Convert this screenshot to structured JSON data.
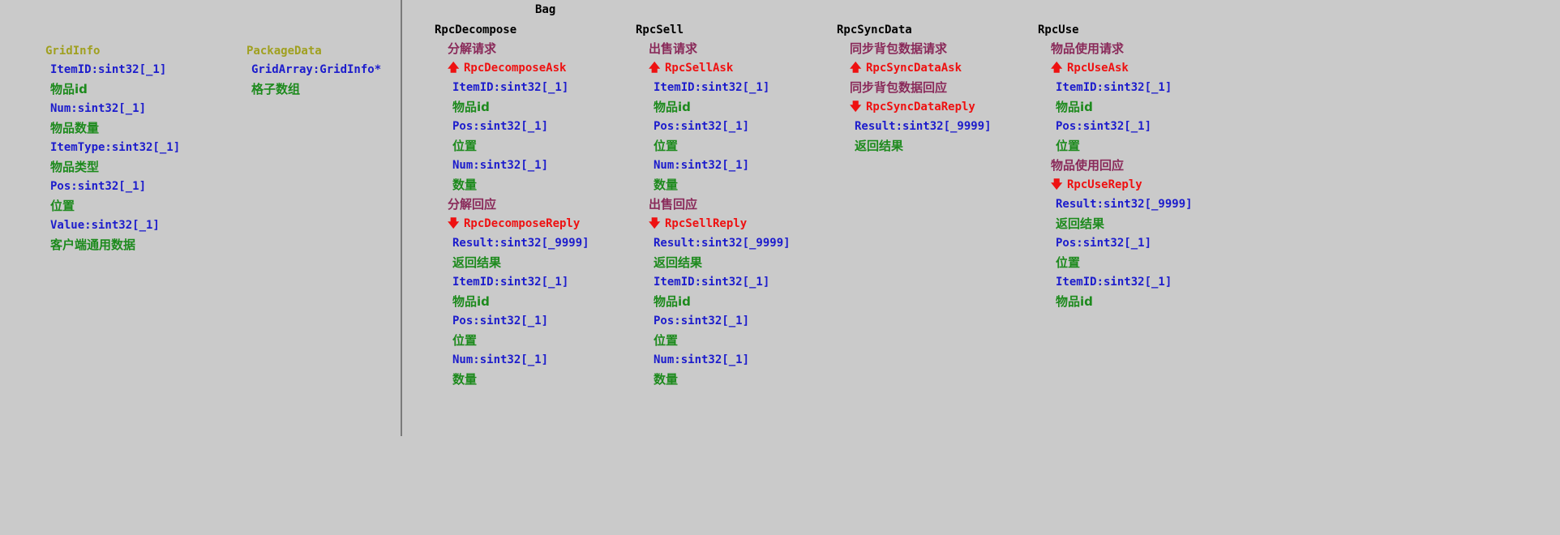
{
  "title": "Bag",
  "structs": [
    {
      "name": "GridInfo",
      "fields": [
        {
          "field": "ItemID:sint32[_1]",
          "desc": "物品id"
        },
        {
          "field": "Num:sint32[_1]",
          "desc": "物品数量"
        },
        {
          "field": "ItemType:sint32[_1]",
          "desc": "物品类型"
        },
        {
          "field": "Pos:sint32[_1]",
          "desc": "位置"
        },
        {
          "field": "Value:sint32[_1]",
          "desc": "客户端通用数据"
        }
      ]
    },
    {
      "name": "PackageData",
      "fields": [
        {
          "field": "GridArray:GridInfo*",
          "desc": "格子数组"
        }
      ]
    }
  ],
  "rpcs": [
    {
      "name": "RpcDecompose",
      "ask_section": "分解请求",
      "ask_arrow": "🡅",
      "ask_name": "RpcDecomposeAsk",
      "ask_fields": [
        {
          "field": "ItemID:sint32[_1]",
          "desc": "物品id"
        },
        {
          "field": "Pos:sint32[_1]",
          "desc": "位置"
        },
        {
          "field": "Num:sint32[_1]",
          "desc": "数量"
        }
      ],
      "reply_section": "分解回应",
      "reply_arrow": "🡇",
      "reply_name": "RpcDecomposeReply",
      "reply_fields": [
        {
          "field": "Result:sint32[_9999]",
          "desc": "返回结果"
        },
        {
          "field": "ItemID:sint32[_1]",
          "desc": "物品id"
        },
        {
          "field": "Pos:sint32[_1]",
          "desc": "位置"
        },
        {
          "field": "Num:sint32[_1]",
          "desc": "数量"
        }
      ]
    },
    {
      "name": "RpcSell",
      "ask_section": "出售请求",
      "ask_arrow": "🡅",
      "ask_name": "RpcSellAsk",
      "ask_fields": [
        {
          "field": "ItemID:sint32[_1]",
          "desc": "物品id"
        },
        {
          "field": "Pos:sint32[_1]",
          "desc": "位置"
        },
        {
          "field": "Num:sint32[_1]",
          "desc": "数量"
        }
      ],
      "reply_section": "出售回应",
      "reply_arrow": "🡇",
      "reply_name": "RpcSellReply",
      "reply_fields": [
        {
          "field": "Result:sint32[_9999]",
          "desc": "返回结果"
        },
        {
          "field": "ItemID:sint32[_1]",
          "desc": "物品id"
        },
        {
          "field": "Pos:sint32[_1]",
          "desc": "位置"
        },
        {
          "field": "Num:sint32[_1]",
          "desc": "数量"
        }
      ]
    },
    {
      "name": "RpcSyncData",
      "ask_section": "同步背包数据请求",
      "ask_arrow": "🡅",
      "ask_name": "RpcSyncDataAsk",
      "ask_fields": [],
      "reply_section": "同步背包数据回应",
      "reply_arrow": "🡇",
      "reply_name": "RpcSyncDataReply",
      "reply_fields": [
        {
          "field": "Result:sint32[_9999]",
          "desc": "返回结果"
        }
      ]
    },
    {
      "name": "RpcUse",
      "ask_section": "物品使用请求",
      "ask_arrow": "🡅",
      "ask_name": "RpcUseAsk",
      "ask_fields": [
        {
          "field": "ItemID:sint32[_1]",
          "desc": "物品id"
        },
        {
          "field": "Pos:sint32[_1]",
          "desc": "位置"
        }
      ],
      "reply_section": "物品使用回应",
      "reply_arrow": "🡇",
      "reply_name": "RpcUseReply",
      "reply_fields": [
        {
          "field": "Result:sint32[_9999]",
          "desc": "返回结果"
        },
        {
          "field": "Pos:sint32[_1]",
          "desc": "位置"
        },
        {
          "field": "ItemID:sint32[_1]",
          "desc": "物品id"
        }
      ]
    }
  ]
}
